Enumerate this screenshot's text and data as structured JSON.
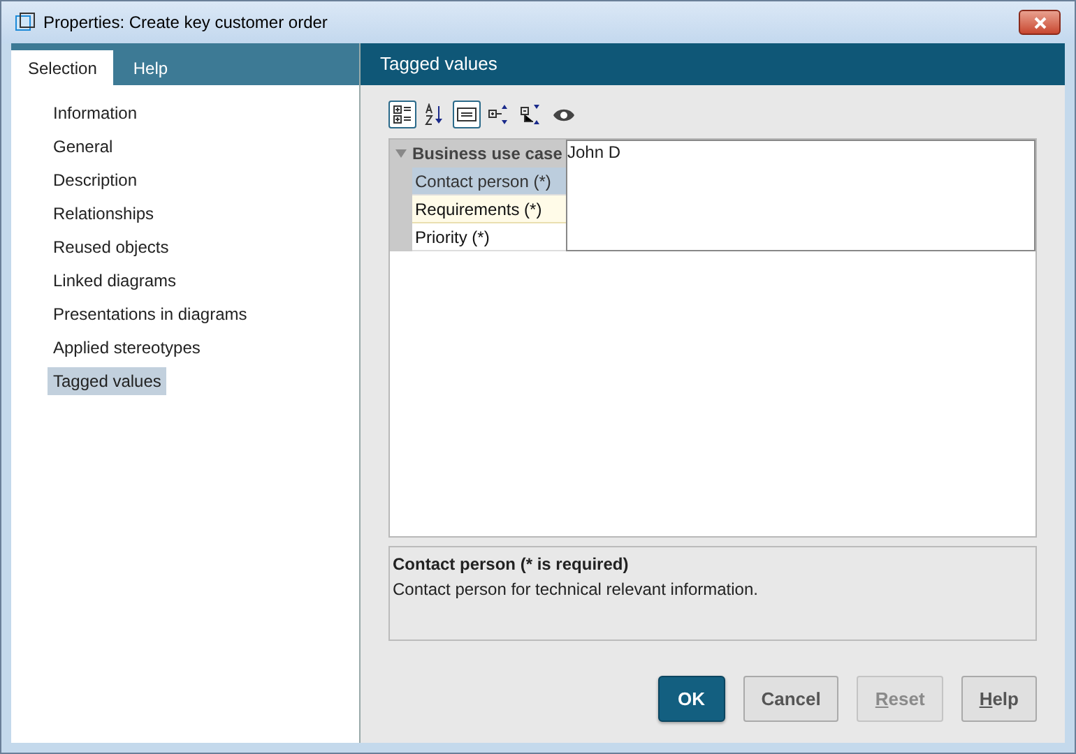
{
  "window": {
    "title": "Properties: Create key customer order"
  },
  "tabs": [
    {
      "label": "Selection",
      "selected": true
    },
    {
      "label": "Help",
      "selected": false
    }
  ],
  "sidebar": {
    "items": [
      {
        "label": "Information",
        "selected": false
      },
      {
        "label": "General",
        "selected": false
      },
      {
        "label": "Description",
        "selected": false
      },
      {
        "label": "Relationships",
        "selected": false
      },
      {
        "label": "Reused objects",
        "selected": false
      },
      {
        "label": "Linked diagrams",
        "selected": false
      },
      {
        "label": "Presentations in diagrams",
        "selected": false
      },
      {
        "label": "Applied stereotypes",
        "selected": false
      },
      {
        "label": "Tagged values",
        "selected": true
      }
    ]
  },
  "panel_title": "Tagged values",
  "toolbar": [
    {
      "kind": "categorized",
      "selected": true
    },
    {
      "kind": "alphabetical",
      "selected": false
    },
    {
      "kind": "description",
      "selected": true
    },
    {
      "kind": "expand",
      "selected": false
    },
    {
      "kind": "collapse",
      "selected": false
    },
    {
      "kind": "view",
      "selected": false
    }
  ],
  "property_grid": {
    "group": {
      "label": "Business use case",
      "expanded": true
    },
    "rows": [
      {
        "label": "Contact person (*)",
        "selected": true,
        "hovered": false
      },
      {
        "label": "Requirements (*)",
        "selected": false,
        "hovered": true
      },
      {
        "label": "Priority (*)",
        "selected": false,
        "hovered": false
      }
    ],
    "editor_value": "John D"
  },
  "description": {
    "title": "Contact person (* is required)",
    "text": "Contact person for technical relevant information."
  },
  "buttons": [
    {
      "label": "OK",
      "kind": "primary",
      "disabled": false,
      "mnemonic": false
    },
    {
      "label": "Cancel",
      "kind": "normal",
      "disabled": false,
      "mnemonic": false
    },
    {
      "label": "Reset",
      "kind": "normal",
      "disabled": true,
      "mnemonic": true
    },
    {
      "label": "Help",
      "kind": "normal",
      "disabled": false,
      "mnemonic": true
    }
  ]
}
